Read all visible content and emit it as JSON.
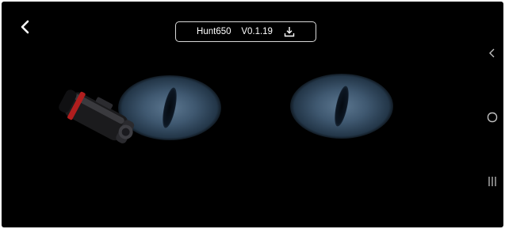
{
  "header": {
    "device_name": "Hunt650",
    "version": "V0.1.19",
    "back_icon": "chevron-left-icon",
    "download_icon": "download-icon"
  },
  "colors": {
    "background": "#000000",
    "eye_blue": "#4a6580",
    "pill_border": "#d8d8d8"
  },
  "nav": {
    "buttons": [
      "back",
      "home",
      "recents"
    ]
  }
}
